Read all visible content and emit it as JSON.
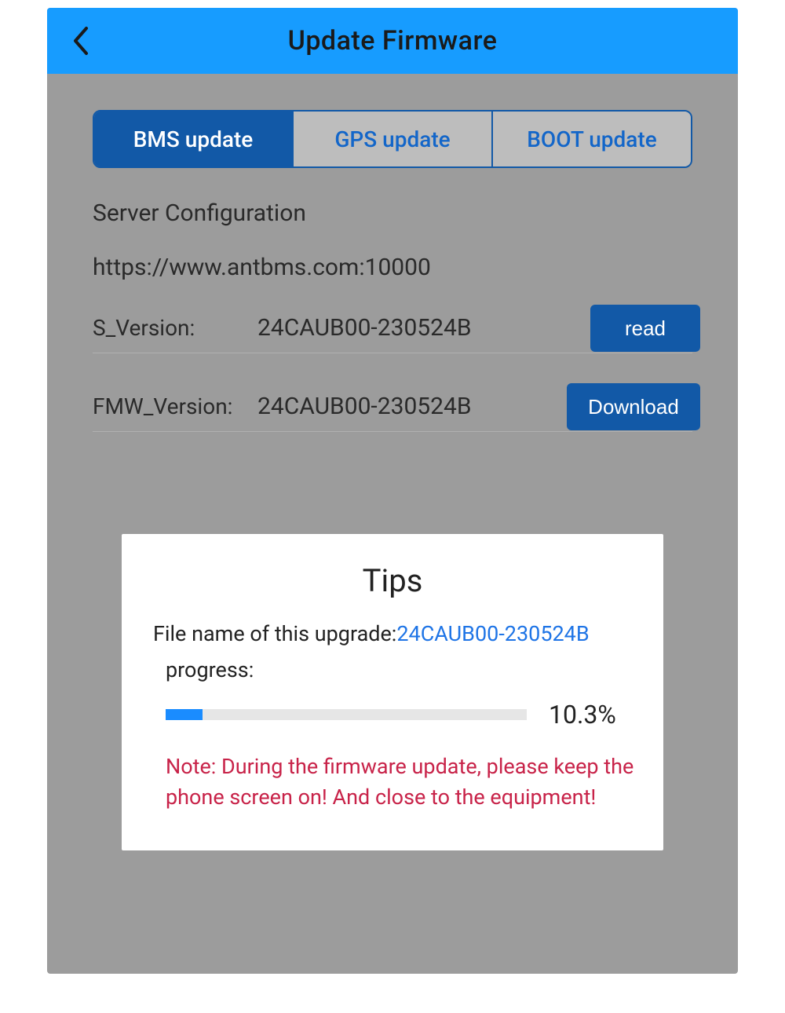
{
  "header": {
    "title": "Update Firmware"
  },
  "tabs": {
    "bms": "BMS update",
    "gps": "GPS update",
    "boot": "BOOT update",
    "active": "bms"
  },
  "server": {
    "label": "Server Configuration",
    "url": "https://www.antbms.com:10000"
  },
  "s_version": {
    "label": "S_Version:",
    "value": "24CAUB00-230524B",
    "button": "read"
  },
  "fmw_version": {
    "label": "FMW_Version:",
    "value": "24CAUB00-230524B",
    "button": "Download"
  },
  "modal": {
    "title": "Tips",
    "upgrade_label": "File name of this upgrade:",
    "file_name": "24CAUB00-230524B",
    "progress_label": "progress:",
    "progress_percent": 10.3,
    "progress_text": "10.3%",
    "note": "Note: During the firmware update, please keep the phone screen on! And close to the equipment!"
  }
}
